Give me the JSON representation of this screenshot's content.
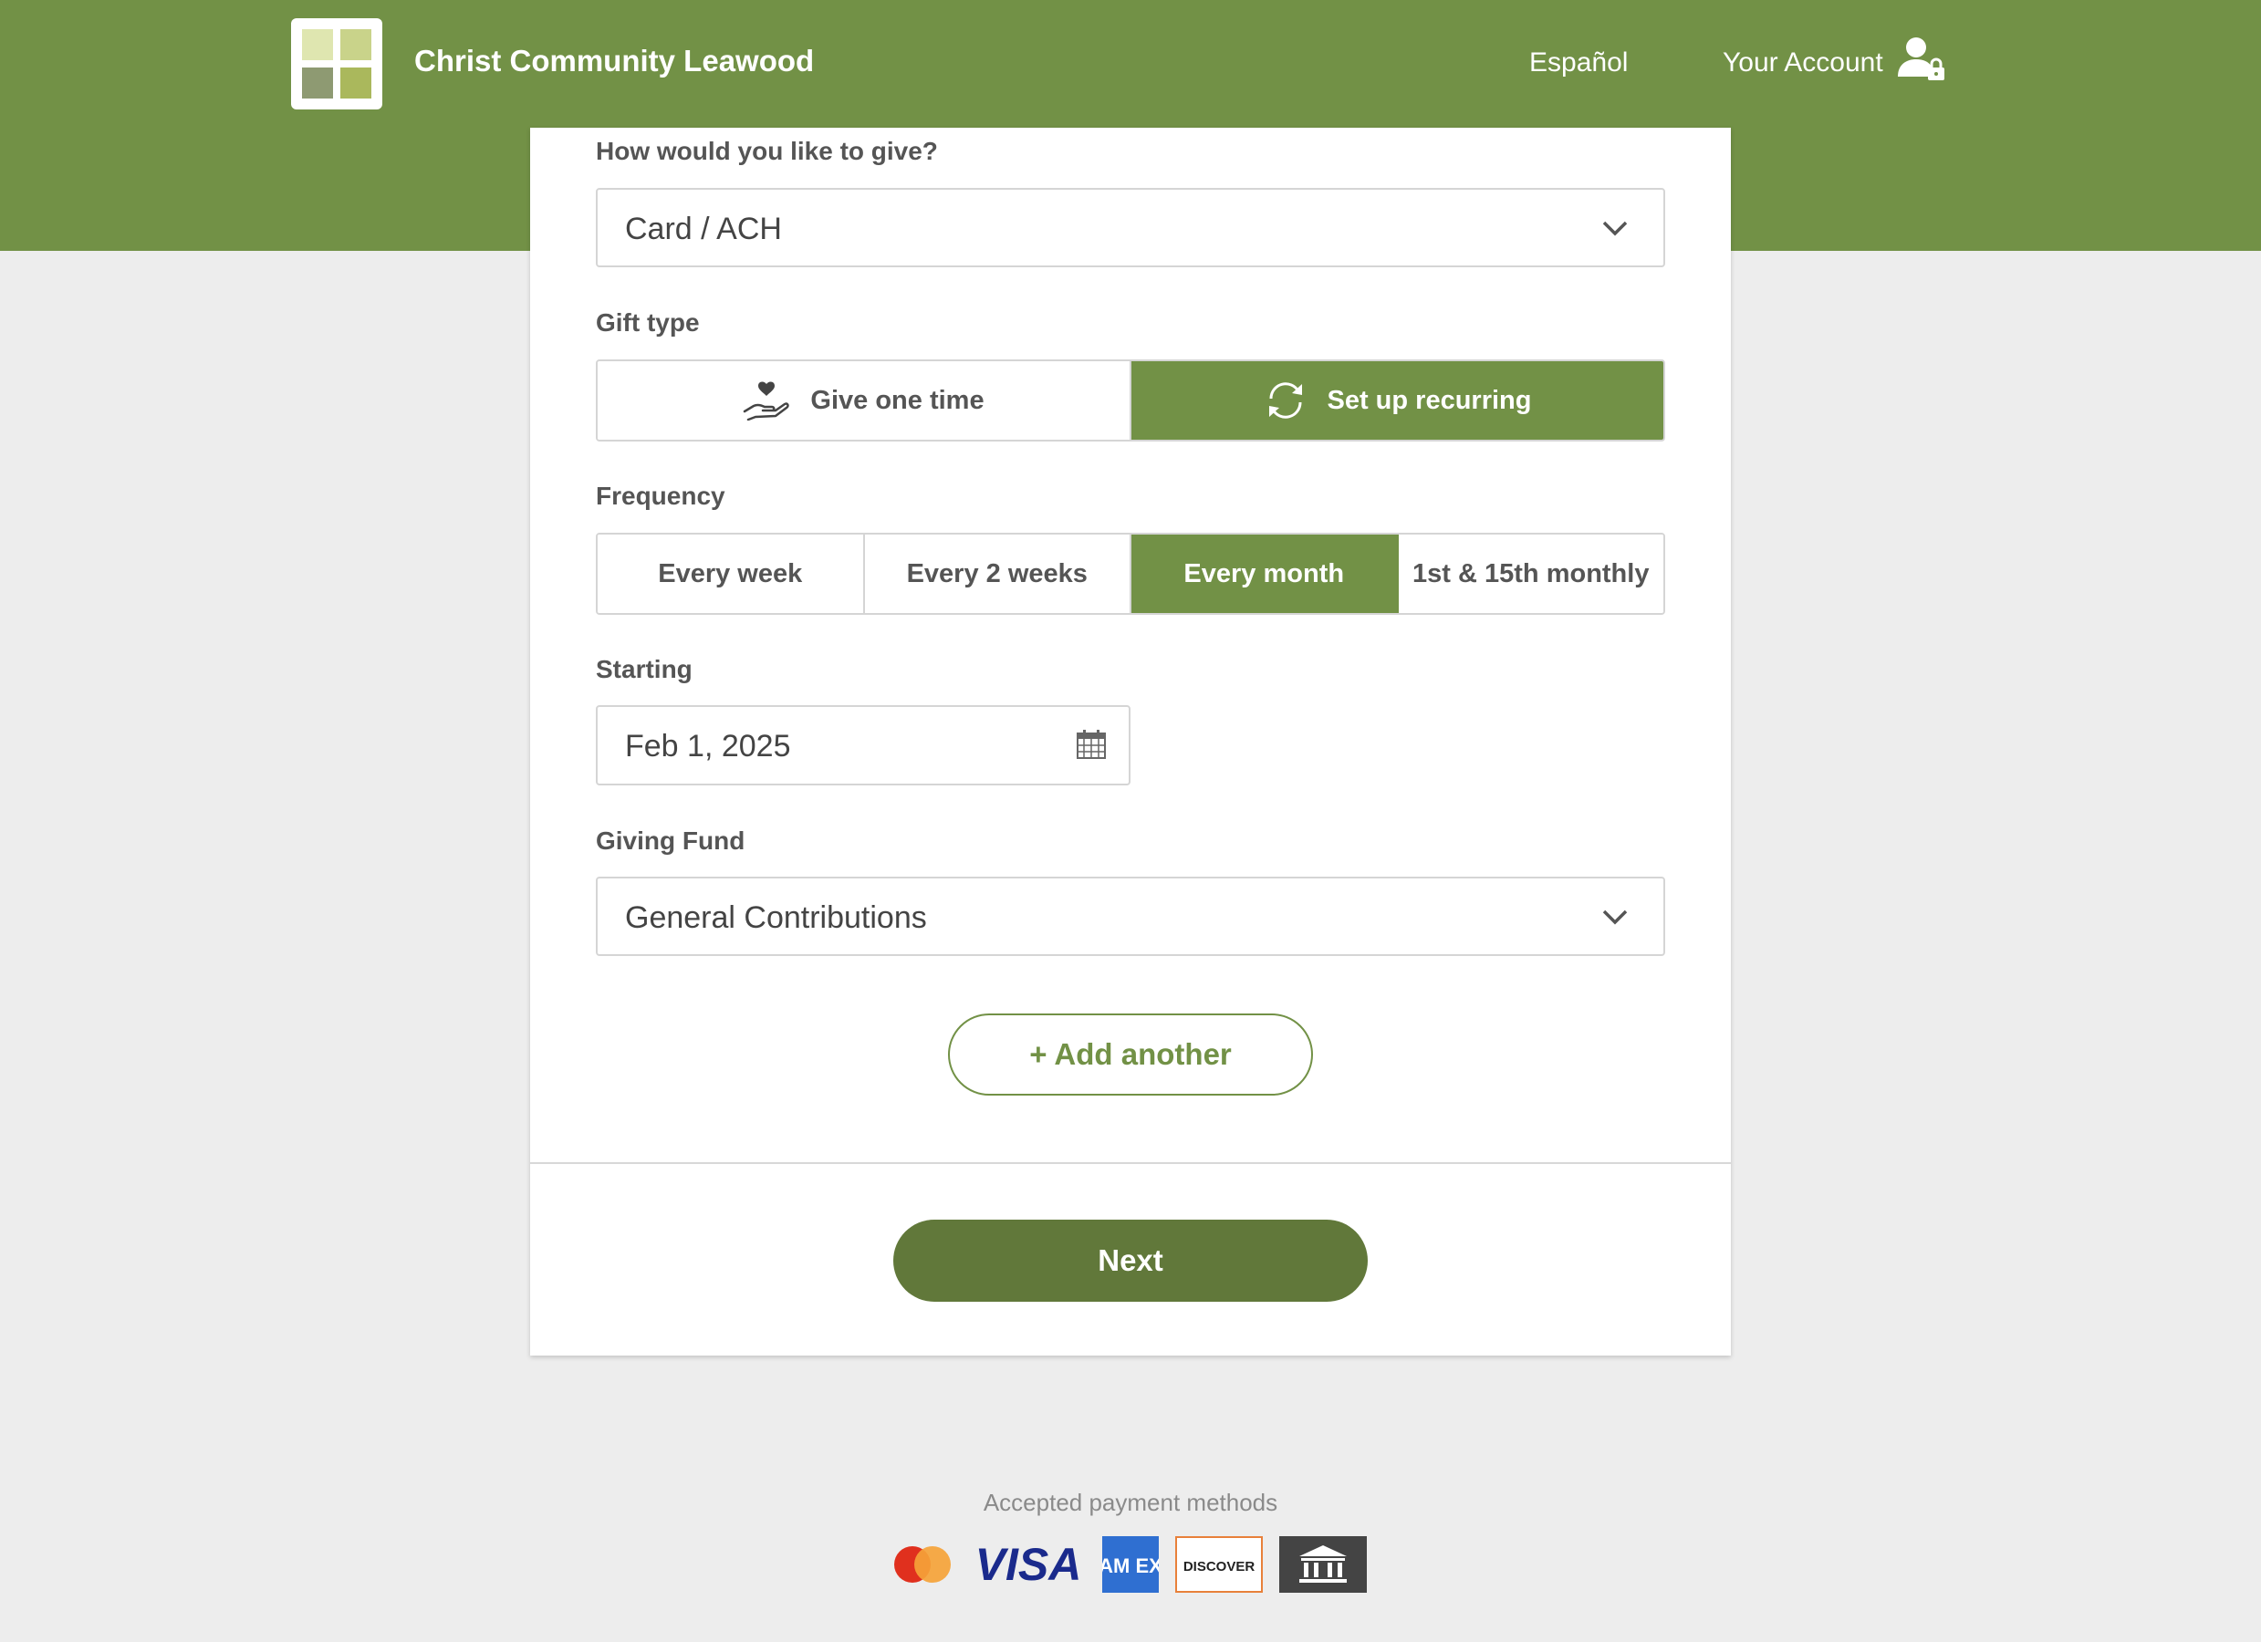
{
  "header": {
    "site_title": "Christ Community Leawood",
    "language_link": "Español",
    "account_link": "Your Account",
    "brand_color": "#729146"
  },
  "form": {
    "method": {
      "label": "How would you like to give?",
      "selected": "Card / ACH"
    },
    "gift_type": {
      "label": "Gift type",
      "options": [
        {
          "label": "Give one time",
          "icon": "hand-heart-icon",
          "selected": false
        },
        {
          "label": "Set up recurring",
          "icon": "recurring-arrows-icon",
          "selected": true
        }
      ]
    },
    "frequency": {
      "label": "Frequency",
      "options": [
        {
          "label": "Every week",
          "selected": false
        },
        {
          "label": "Every 2 weeks",
          "selected": false
        },
        {
          "label": "Every month",
          "selected": true
        },
        {
          "label": "1st & 15th monthly",
          "selected": false
        }
      ]
    },
    "starting": {
      "label": "Starting",
      "value": "Feb 1, 2025"
    },
    "fund": {
      "label": "Giving Fund",
      "selected": "General Contributions"
    },
    "add_another_label": "+ Add another",
    "next_label": "Next"
  },
  "footer": {
    "accepted_label": "Accepted payment methods",
    "methods": [
      "mastercard-icon",
      "visa-icon",
      "amex-icon",
      "discover-icon",
      "bank-icon"
    ],
    "visa_text": "VISA",
    "amex_text": "AM EX",
    "discover_text": "DISCOVER"
  }
}
